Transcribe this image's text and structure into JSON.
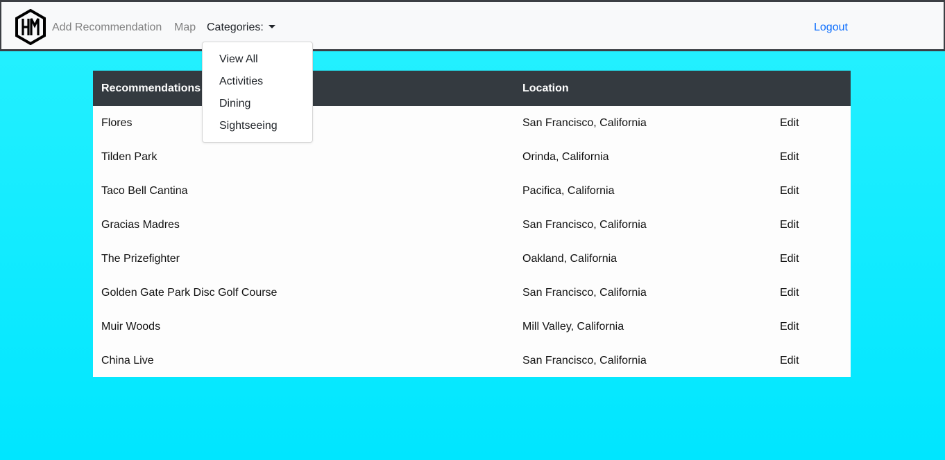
{
  "nav": {
    "logo_icon": "hm-hexagon-logo-icon",
    "add_recommendation": "Add Recommendation",
    "map": "Map",
    "categories": "Categories:",
    "logout": "Logout"
  },
  "dropdown": {
    "items": [
      "View All",
      "Activities",
      "Dining",
      "Sightseeing"
    ]
  },
  "table": {
    "headers": {
      "recommendations": "Recommendations",
      "location": "Location"
    },
    "rows": [
      {
        "name": "Flores",
        "location": "San Francisco, California",
        "action": "Edit"
      },
      {
        "name": "Tilden Park",
        "location": "Orinda, California",
        "action": "Edit"
      },
      {
        "name": "Taco Bell Cantina",
        "location": "Pacifica, California",
        "action": "Edit"
      },
      {
        "name": "Gracias Madres",
        "location": "San Francisco, California",
        "action": "Edit"
      },
      {
        "name": "The Prizefighter",
        "location": "Oakland, California",
        "action": "Edit"
      },
      {
        "name": "Golden Gate Park Disc Golf Course",
        "location": "San Francisco, California",
        "action": "Edit"
      },
      {
        "name": "Muir Woods",
        "location": "Mill Valley, California",
        "action": "Edit"
      },
      {
        "name": "China Live",
        "location": "San Francisco, California",
        "action": "Edit"
      }
    ]
  },
  "colors": {
    "background_top": "#27f1ff",
    "background_bottom": "#00e6ff",
    "navbar": "#f8f9fa",
    "table_header": "#343a40",
    "link_blue": "#0d6efd"
  }
}
